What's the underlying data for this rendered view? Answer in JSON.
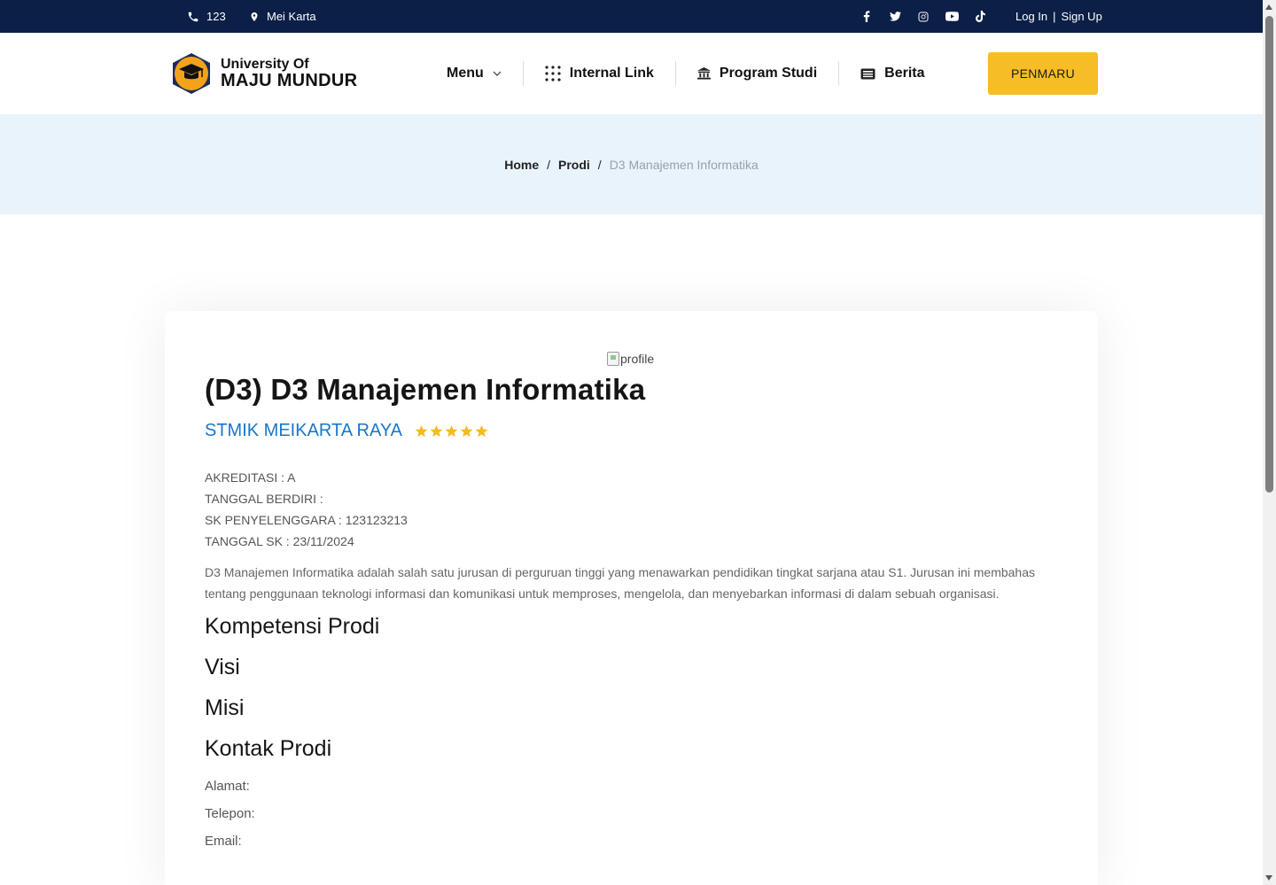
{
  "topbar": {
    "phone": "123",
    "location": "Mei Karta",
    "social_icons": [
      "facebook-icon",
      "twitter-icon",
      "instagram-icon",
      "youtube-icon",
      "tiktok-icon"
    ],
    "login": "Log In",
    "divider": "|",
    "signup": "Sign Up"
  },
  "header": {
    "logo_line1": "University Of",
    "logo_line2": "MAJU MUNDUR",
    "nav": [
      {
        "label": "Menu",
        "icon": "chevron-down-icon"
      },
      {
        "label": "Internal Link",
        "icon": "grid-dots-icon"
      },
      {
        "label": "Program Studi",
        "icon": "bank-icon"
      },
      {
        "label": "Berita",
        "icon": "newspaper-icon"
      }
    ],
    "cta": "PENMARU"
  },
  "breadcrumb": {
    "home": "Home",
    "sep": "/",
    "prodi": "Prodi",
    "current": "D3 Manajemen Informatika"
  },
  "prodi": {
    "image_alt": "profile",
    "title": "(D3) D3 Manajemen Informatika",
    "institution": "STMIK MEIKARTA RAYA",
    "rating_stars": 5,
    "akreditasi": "AKREDITASI : A",
    "tanggal_berdiri": "TANGGAL BERDIRI :",
    "sk": "SK PENYELENGGARA : 123123213",
    "tanggal_sk": "TANGGAL SK : 23/11/2024",
    "description": "D3 Manajemen Informatika adalah salah satu jurusan di perguruan tinggi yang menawarkan pendidikan tingkat sarjana atau S1. Jurusan ini membahas tentang penggunaan teknologi informasi dan komunikasi untuk memproses, mengelola, dan menyebarkan informasi di dalam sebuah organisasi.",
    "kompetensi_heading": "Kompetensi Prodi",
    "visi_heading": "Visi",
    "misi_heading": "Misi",
    "kontak_heading": "Kontak Prodi",
    "alamat": "Alamat:",
    "telepon": "Telepon:",
    "email": "Email:"
  },
  "colors": {
    "topbar": "#0b1f47",
    "accent": "#f7bd24",
    "link": "#1976c9",
    "breadcrumb_bg": "#e9f3fc"
  }
}
